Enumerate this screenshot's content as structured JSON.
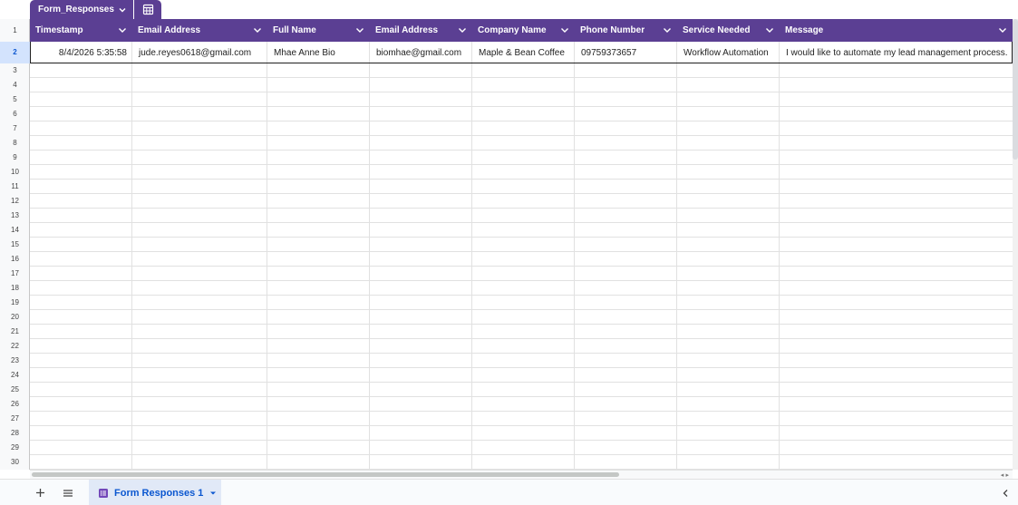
{
  "table_chip": {
    "name": "Form_Responses"
  },
  "columns": [
    {
      "label": "Timestamp"
    },
    {
      "label": "Email Address"
    },
    {
      "label": "Full Name"
    },
    {
      "label": "Email Address"
    },
    {
      "label": "Company Name"
    },
    {
      "label": "Phone Number"
    },
    {
      "label": "Service Needed"
    },
    {
      "label": "Message"
    }
  ],
  "rows": [
    {
      "timestamp": "8/4/2026 5:35:58",
      "email": "jude.reyes0618@gmail.com",
      "full_name": "Mhae Anne Bio",
      "email2": "biomhae@gmail.com",
      "company": "Maple & Bean Coffee",
      "phone": "09759373657",
      "service": "Workflow Automation",
      "message": "I would like to automate my lead management process."
    }
  ],
  "row_numbers": [
    "1",
    "2",
    "3",
    "4",
    "5",
    "6",
    "7",
    "8",
    "9",
    "10",
    "11",
    "12",
    "13",
    "14",
    "15",
    "16",
    "17",
    "18",
    "19",
    "20",
    "21",
    "22",
    "23",
    "24",
    "25",
    "26",
    "27",
    "28",
    "29",
    "30"
  ],
  "selected_row": "2",
  "sheet_tab": {
    "label": "Form Responses 1"
  },
  "colors": {
    "header": "#5b3f93",
    "selected_row_bg": "#d3e3fd",
    "tab_text": "#0b57d0"
  }
}
